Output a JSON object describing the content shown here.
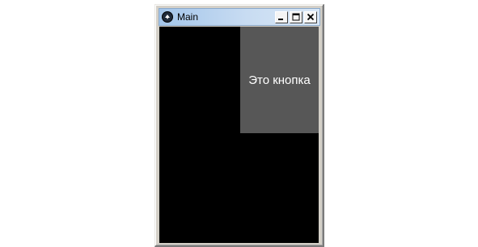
{
  "window": {
    "title": "Main",
    "icon": "kivy-logo-icon",
    "controls": [
      {
        "name": "minimize-button",
        "icon": "minimize-icon"
      },
      {
        "name": "maximize-button",
        "icon": "maximize-icon"
      },
      {
        "name": "close-button",
        "icon": "close-icon"
      }
    ]
  },
  "content": {
    "background_color": "#000000",
    "button": {
      "label": "Это кнопка",
      "background_color": "#575757",
      "text_color": "#ffffff"
    }
  }
}
